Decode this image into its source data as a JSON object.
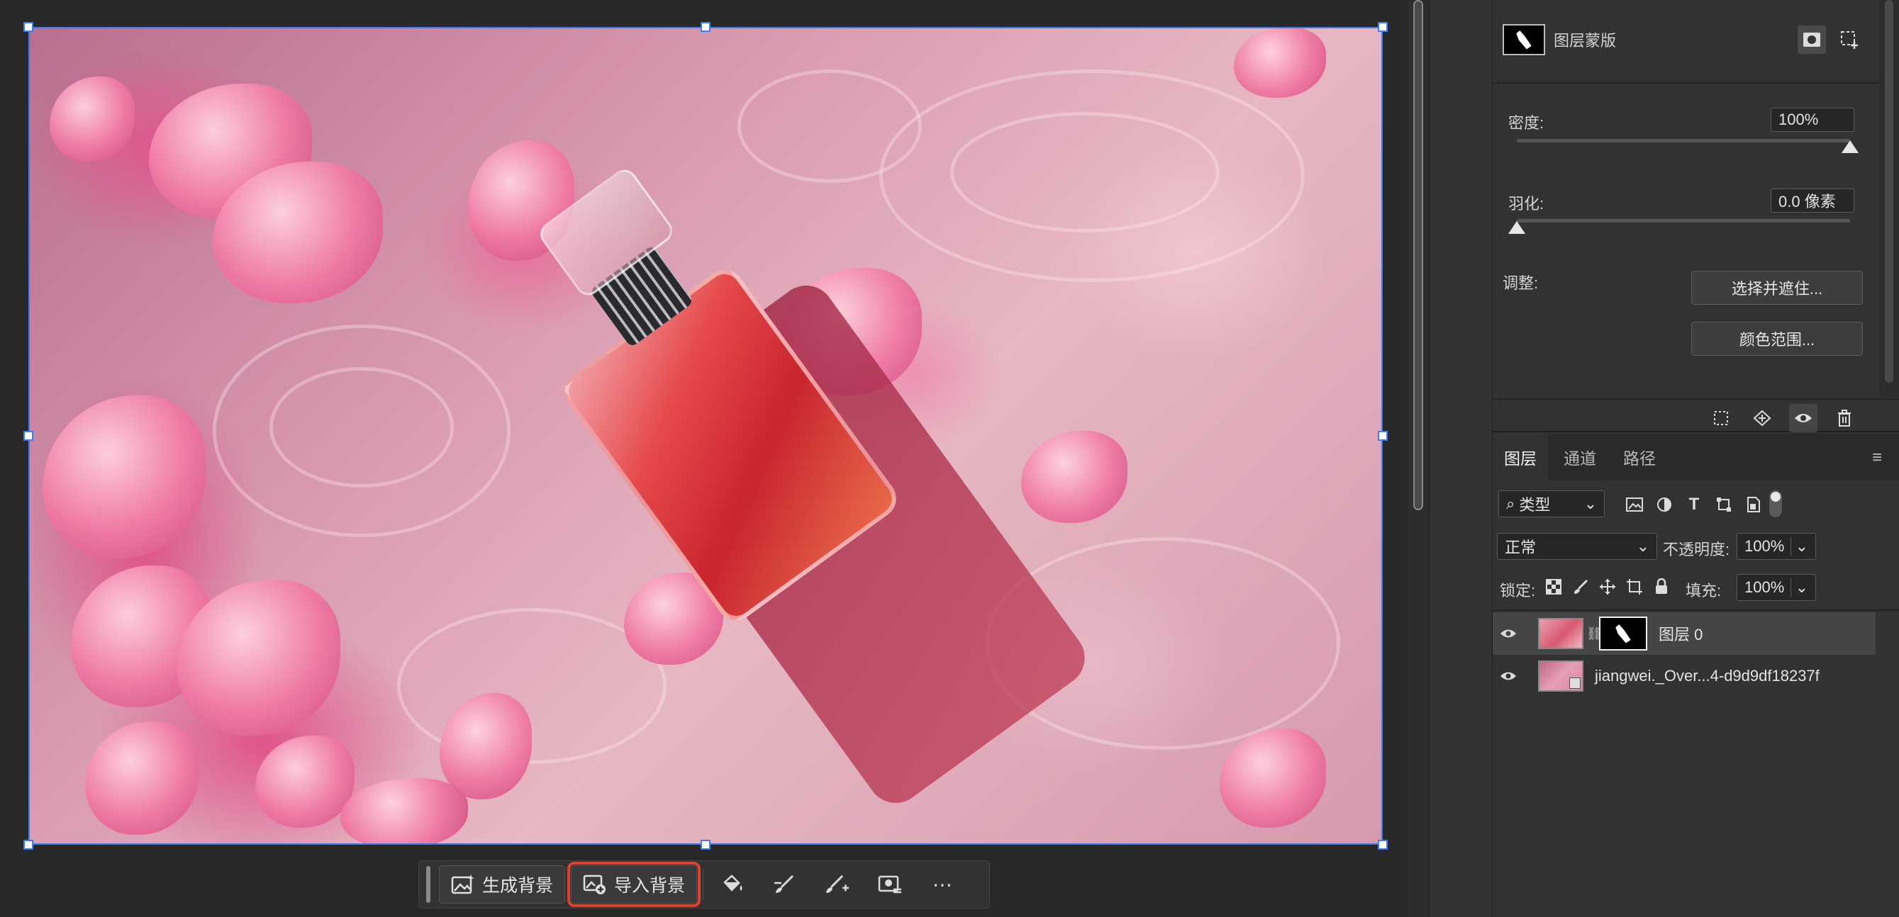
{
  "taskbar": {
    "generate_background": "生成背景",
    "import_background": "导入背景",
    "more": "⋯"
  },
  "properties": {
    "title": "图层蒙版",
    "density_label": "密度:",
    "density_value": "100%",
    "density_level": 1.0,
    "feather_label": "羽化:",
    "feather_value": "0.0 像素",
    "feather_level": 0.0,
    "adjust_label": "调整:",
    "select_and_mask": "选择并遮住...",
    "color_range": "颜色范围..."
  },
  "layers_panel": {
    "tabs": [
      "图层",
      "通道",
      "路径"
    ],
    "active_tab": "图层",
    "filter_kind": "类型",
    "blend_mode": "正常",
    "opacity_label": "不透明度:",
    "opacity_value": "100%",
    "lock_label": "锁定:",
    "fill_label": "填充:",
    "fill_value": "100%",
    "layers": [
      {
        "name": "图层 0",
        "selected": true
      },
      {
        "name": "jiangwei._Over...4-d9d9df18237f",
        "selected": false
      }
    ]
  },
  "colors": {
    "selection": "#3b7df6",
    "highlight": "#e0402e",
    "panel": "#323232"
  }
}
